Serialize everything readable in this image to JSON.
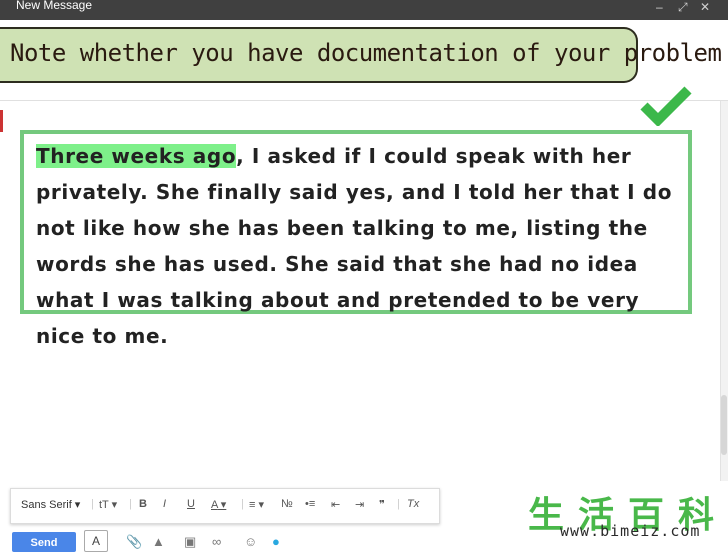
{
  "window": {
    "title": "New Message"
  },
  "caption": {
    "text": "Note whether you have documentation of your problem"
  },
  "body": {
    "highlight": "Three weeks ago",
    "text": ", I asked if I could speak with her privately. She finally said yes, and I told her that I do not like how she has been talking to me, listing the words she has used. She said that she had no idea what I was talking about and pretended to be very nice to me."
  },
  "toolbar": {
    "font": "Sans Serif",
    "size_icon": "tT",
    "bold": "B",
    "italic": "I",
    "underline": "U",
    "text_color": "A",
    "quote": "❞",
    "clear": "Tx"
  },
  "footer": {
    "send_label": "Send",
    "format_label": "A"
  },
  "watermark": {
    "chars": "生活百科",
    "url": "www.bimeiz.com"
  },
  "colors": {
    "highlight": "#7ef08a",
    "box_border": "#74c97e",
    "caption_bg": "#cfe2b4",
    "send": "#4a86e8"
  }
}
